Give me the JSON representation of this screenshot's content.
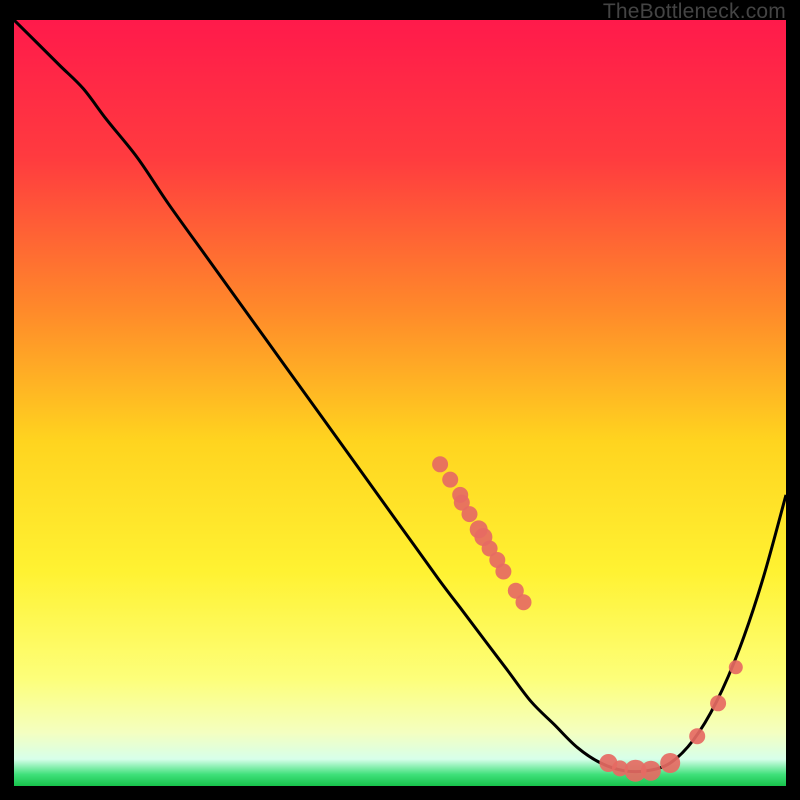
{
  "watermark": "TheBottleneck.com",
  "chart_data": {
    "type": "line",
    "title": "",
    "xlabel": "",
    "ylabel": "",
    "xlim": [
      0,
      100
    ],
    "ylim": [
      0,
      100
    ],
    "background_gradient": {
      "stops": [
        {
          "offset": 0.0,
          "color": "#ff1a4b"
        },
        {
          "offset": 0.18,
          "color": "#ff3b3f"
        },
        {
          "offset": 0.38,
          "color": "#ff8a2a"
        },
        {
          "offset": 0.55,
          "color": "#ffd41f"
        },
        {
          "offset": 0.72,
          "color": "#fff232"
        },
        {
          "offset": 0.86,
          "color": "#fdff7a"
        },
        {
          "offset": 0.93,
          "color": "#f4ffc0"
        },
        {
          "offset": 0.965,
          "color": "#d7ffea"
        },
        {
          "offset": 0.985,
          "color": "#3fe07a"
        },
        {
          "offset": 1.0,
          "color": "#17c24b"
        }
      ]
    },
    "series": [
      {
        "name": "bottleneck-curve",
        "color": "#000000",
        "x": [
          0,
          3,
          6,
          9,
          12,
          16,
          20,
          25,
          30,
          35,
          40,
          45,
          50,
          55,
          58,
          61,
          64,
          67,
          70,
          73,
          76,
          79,
          82,
          85,
          88,
          91,
          94,
          97,
          100
        ],
        "y": [
          100,
          97,
          94,
          91,
          87,
          82,
          76,
          69,
          62,
          55,
          48,
          41,
          34,
          27,
          23,
          19,
          15,
          11,
          8,
          5,
          3,
          2,
          2,
          3,
          6,
          11,
          18,
          27,
          38
        ]
      }
    ],
    "markers": {
      "name": "highlighted-points",
      "color": "#e66a63",
      "points": [
        {
          "x": 55.2,
          "y": 42.0,
          "r": 8
        },
        {
          "x": 56.5,
          "y": 40.0,
          "r": 8
        },
        {
          "x": 57.8,
          "y": 38.0,
          "r": 8
        },
        {
          "x": 58.0,
          "y": 37.0,
          "r": 8
        },
        {
          "x": 59.0,
          "y": 35.5,
          "r": 8
        },
        {
          "x": 60.2,
          "y": 33.5,
          "r": 9
        },
        {
          "x": 60.8,
          "y": 32.5,
          "r": 9
        },
        {
          "x": 61.6,
          "y": 31.0,
          "r": 8
        },
        {
          "x": 62.6,
          "y": 29.5,
          "r": 8
        },
        {
          "x": 63.4,
          "y": 28.0,
          "r": 8
        },
        {
          "x": 65.0,
          "y": 25.5,
          "r": 8
        },
        {
          "x": 66.0,
          "y": 24.0,
          "r": 8
        },
        {
          "x": 77.0,
          "y": 3.0,
          "r": 9
        },
        {
          "x": 78.5,
          "y": 2.3,
          "r": 8
        },
        {
          "x": 80.5,
          "y": 2.0,
          "r": 11
        },
        {
          "x": 82.5,
          "y": 2.0,
          "r": 10
        },
        {
          "x": 85.0,
          "y": 3.0,
          "r": 10
        },
        {
          "x": 88.5,
          "y": 6.5,
          "r": 8
        },
        {
          "x": 91.2,
          "y": 10.8,
          "r": 8
        },
        {
          "x": 93.5,
          "y": 15.5,
          "r": 7
        }
      ]
    }
  }
}
